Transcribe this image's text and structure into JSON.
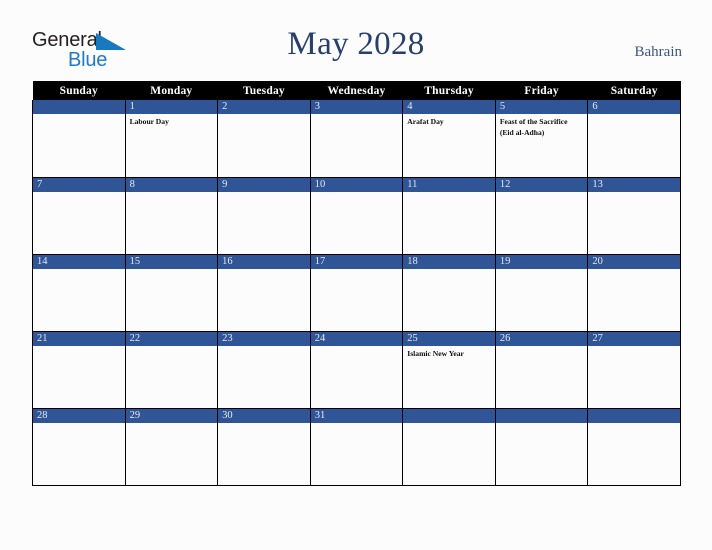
{
  "brand": {
    "word1": "General",
    "word2": "Blue",
    "triangle_color": "#1878c0",
    "word1_color": "#231f20",
    "word2_color": "#1f7bc4"
  },
  "header": {
    "title": "May 2028",
    "country": "Bahrain",
    "title_color": "#27406b"
  },
  "theme": {
    "header_bar_bg": "#000000",
    "daynum_bar_bg": "#2f5596",
    "page_bg": "#fcfcfd",
    "grid_line": "#000000"
  },
  "weekdays": [
    "Sunday",
    "Monday",
    "Tuesday",
    "Wednesday",
    "Thursday",
    "Friday",
    "Saturday"
  ],
  "weeks": [
    [
      {
        "day": "",
        "events": []
      },
      {
        "day": "1",
        "events": [
          "Labour Day"
        ]
      },
      {
        "day": "2",
        "events": []
      },
      {
        "day": "3",
        "events": []
      },
      {
        "day": "4",
        "events": [
          "Arafat Day"
        ]
      },
      {
        "day": "5",
        "events": [
          "Feast of the Sacrifice (Eid al-Adha)"
        ]
      },
      {
        "day": "6",
        "events": []
      }
    ],
    [
      {
        "day": "7",
        "events": []
      },
      {
        "day": "8",
        "events": []
      },
      {
        "day": "9",
        "events": []
      },
      {
        "day": "10",
        "events": []
      },
      {
        "day": "11",
        "events": []
      },
      {
        "day": "12",
        "events": []
      },
      {
        "day": "13",
        "events": []
      }
    ],
    [
      {
        "day": "14",
        "events": []
      },
      {
        "day": "15",
        "events": []
      },
      {
        "day": "16",
        "events": []
      },
      {
        "day": "17",
        "events": []
      },
      {
        "day": "18",
        "events": []
      },
      {
        "day": "19",
        "events": []
      },
      {
        "day": "20",
        "events": []
      }
    ],
    [
      {
        "day": "21",
        "events": []
      },
      {
        "day": "22",
        "events": []
      },
      {
        "day": "23",
        "events": []
      },
      {
        "day": "24",
        "events": []
      },
      {
        "day": "25",
        "events": [
          "Islamic New Year"
        ]
      },
      {
        "day": "26",
        "events": []
      },
      {
        "day": "27",
        "events": []
      }
    ],
    [
      {
        "day": "28",
        "events": []
      },
      {
        "day": "29",
        "events": []
      },
      {
        "day": "30",
        "events": []
      },
      {
        "day": "31",
        "events": []
      },
      {
        "day": "",
        "events": []
      },
      {
        "day": "",
        "events": []
      },
      {
        "day": "",
        "events": []
      }
    ]
  ]
}
